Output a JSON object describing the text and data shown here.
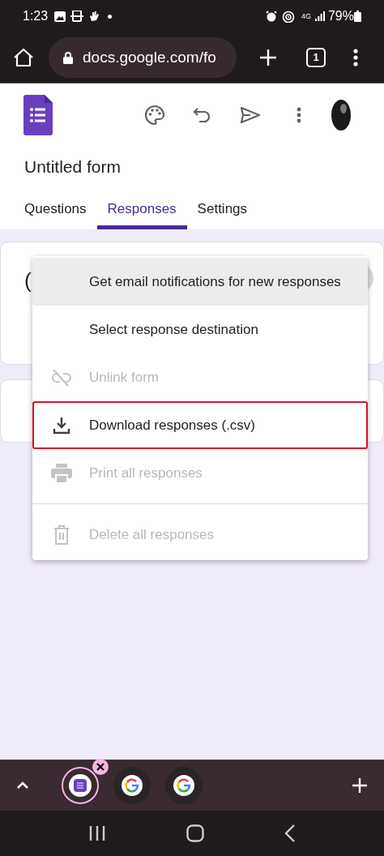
{
  "status_bar": {
    "time": "1:23",
    "network": "4G",
    "battery": "79%"
  },
  "browser": {
    "url": "docs.google.com/fo",
    "tab_count": "1"
  },
  "form": {
    "title": "Untitled form",
    "tabs": [
      {
        "label": "Questions",
        "selected": false
      },
      {
        "label": "Responses",
        "selected": true
      },
      {
        "label": "Settings",
        "selected": false
      }
    ],
    "card_text": "("
  },
  "menu": {
    "items": [
      {
        "kind": "plain",
        "label": "Get email notifications for new responses",
        "hovered": true,
        "disabled": false,
        "outlined": false
      },
      {
        "kind": "plain",
        "label": "Select response destination",
        "hovered": false,
        "disabled": false,
        "outlined": false
      },
      {
        "kind": "unlink",
        "label": "Unlink form",
        "hovered": false,
        "disabled": true,
        "outlined": false
      },
      {
        "kind": "download",
        "label": "Download responses (.csv)",
        "hovered": false,
        "disabled": false,
        "outlined": true
      },
      {
        "kind": "print",
        "label": "Print all responses",
        "hovered": false,
        "disabled": true,
        "outlined": false
      },
      {
        "kind": "divider"
      },
      {
        "kind": "delete",
        "label": "Delete all responses",
        "hovered": false,
        "disabled": true,
        "outlined": false
      }
    ]
  },
  "tab_strip": {
    "tabs": [
      {
        "kind": "forms",
        "selected": true
      },
      {
        "kind": "google",
        "selected": false
      },
      {
        "kind": "google",
        "selected": false
      }
    ]
  }
}
